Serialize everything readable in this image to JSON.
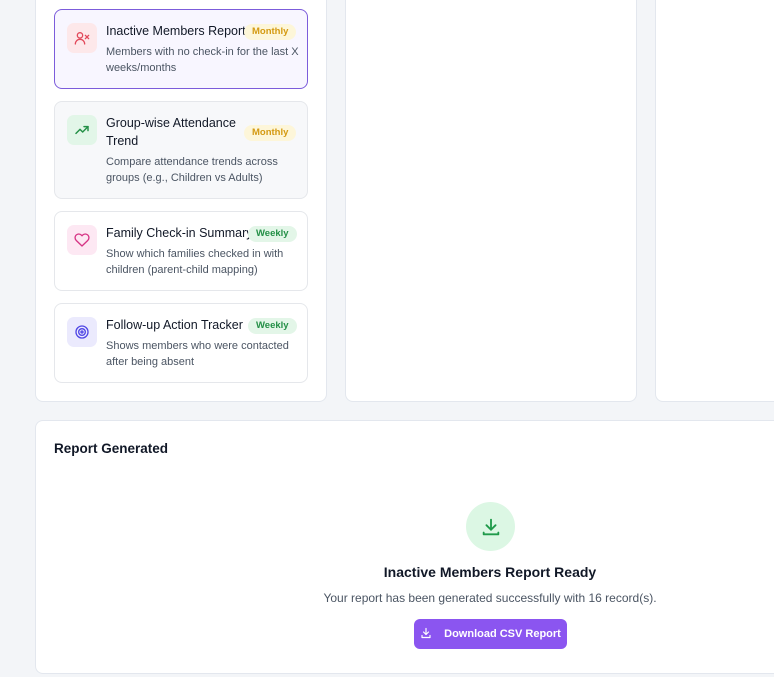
{
  "report_types": [
    {
      "title": "Inactive Members Report",
      "description": "Members with no check-in for the last X weeks/months",
      "frequency": "Monthly",
      "icon": "user-x-icon",
      "selected": true
    },
    {
      "title": "Group-wise Attendance Trend",
      "description": "Compare attendance trends across groups (e.g., Children vs Adults)",
      "frequency": "Monthly",
      "icon": "trending-up-icon",
      "selected": false
    },
    {
      "title": "Family Check-in Summary",
      "description": "Show which families checked in with children (parent-child mapping)",
      "frequency": "Weekly",
      "icon": "heart-icon",
      "selected": false
    },
    {
      "title": "Follow-up Action Tracker",
      "description": "Shows members who were contacted after being absent",
      "frequency": "Weekly",
      "icon": "target-icon",
      "selected": false
    }
  ],
  "report_result": {
    "heading": "Report Generated",
    "title": "Inactive Members Report Ready",
    "message": "Your report has been generated successfully with 16 record(s).",
    "download_label": "Download CSV Report",
    "icon": "download-icon"
  },
  "colors": {
    "accent": "#8b55f0",
    "selected_border": "#7c5cdb",
    "monthly_badge": "#d49a12",
    "weekly_badge": "#249047",
    "success_bg": "#dcf7e4"
  }
}
